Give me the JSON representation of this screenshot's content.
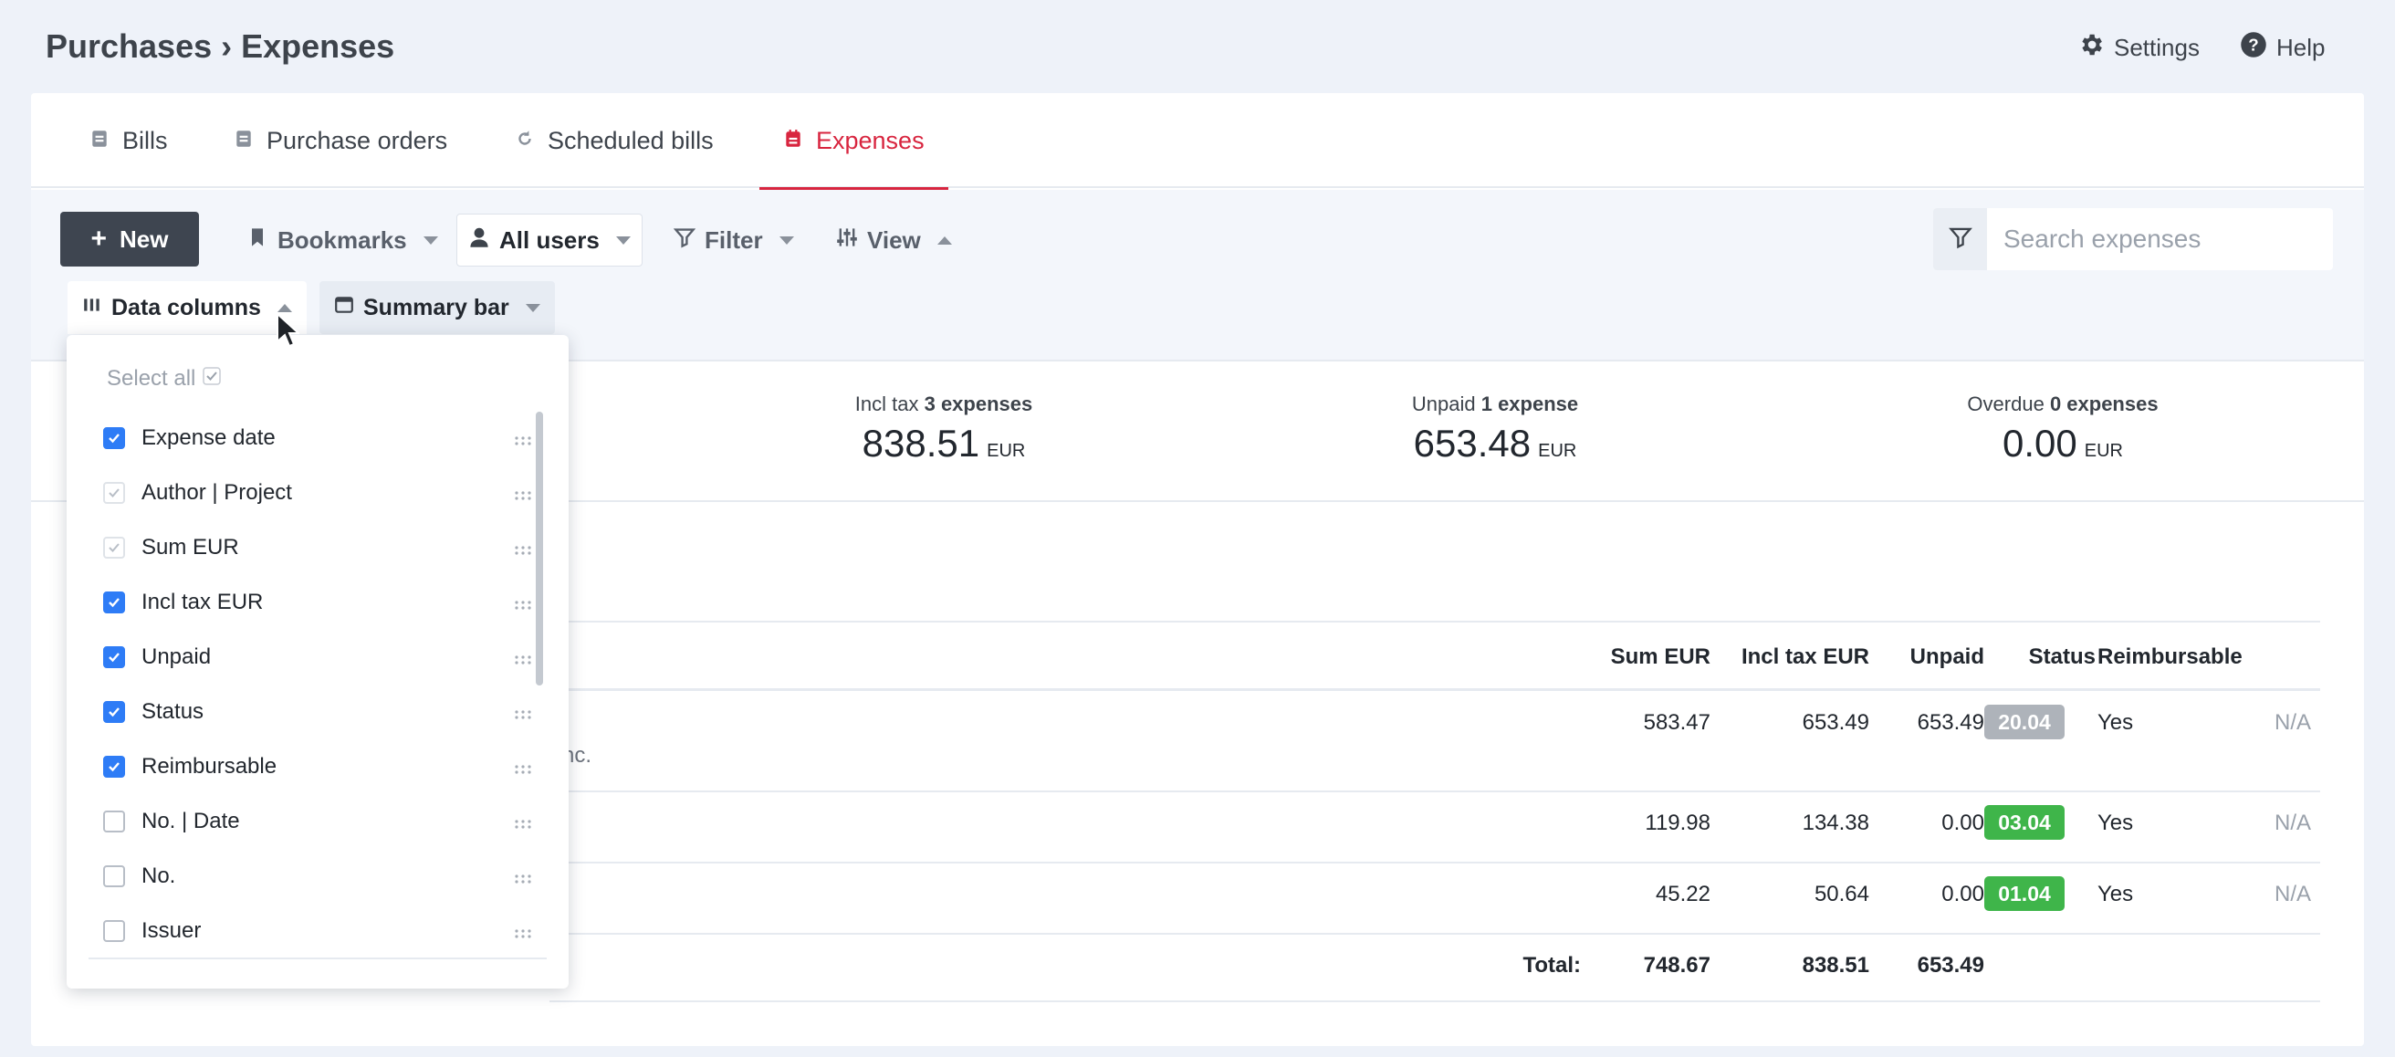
{
  "header": {
    "breadcrumb": "Purchases › Expenses",
    "settings_label": "Settings",
    "help_label": "Help"
  },
  "tabs": [
    {
      "label": "Bills",
      "icon": "document-icon"
    },
    {
      "label": "Purchase orders",
      "icon": "document-icon"
    },
    {
      "label": "Scheduled bills",
      "icon": "refresh-icon"
    },
    {
      "label": "Expenses",
      "icon": "calendar-icon",
      "active": true
    }
  ],
  "toolbar": {
    "new_label": "New",
    "bookmarks_label": "Bookmarks",
    "users_label": "All users",
    "filter_label": "Filter",
    "view_label": "View",
    "search_placeholder": "Search expenses",
    "data_columns_label": "Data columns",
    "summary_bar_label": "Summary bar"
  },
  "summary": {
    "incl_tax": {
      "label": "Incl tax",
      "count": "3 expenses",
      "value": "838.51",
      "currency": "EUR"
    },
    "unpaid": {
      "label": "Unpaid",
      "count": "1 expense",
      "value": "653.48",
      "currency": "EUR"
    },
    "overdue": {
      "label": "Overdue",
      "count": "0 expenses",
      "value": "0.00",
      "currency": "EUR"
    }
  },
  "table": {
    "headers": {
      "sum": "Sum EUR",
      "incl_tax": "Incl tax EUR",
      "unpaid": "Unpaid",
      "status": "Status",
      "reimbursable": "Reimbursable"
    },
    "rows": [
      {
        "partial_text": "nc.",
        "sum": "583.47",
        "incl_tax": "653.49",
        "unpaid": "653.49",
        "status": "20.04",
        "status_color": "#aeb3ba",
        "reimbursable": "Yes",
        "extra": "N/A"
      },
      {
        "partial_text": "",
        "sum": "119.98",
        "incl_tax": "134.38",
        "unpaid": "0.00",
        "status": "03.04",
        "status_color": "#3fb54a",
        "reimbursable": "Yes",
        "extra": "N/A"
      },
      {
        "partial_text": "",
        "sum": "45.22",
        "incl_tax": "50.64",
        "unpaid": "0.00",
        "status": "01.04",
        "status_color": "#3fb54a",
        "reimbursable": "Yes",
        "extra": "N/A"
      }
    ],
    "total": {
      "label": "Total:",
      "sum": "748.67",
      "incl_tax": "838.51",
      "unpaid": "653.49"
    }
  },
  "columns_dropdown": {
    "select_all_label": "Select all",
    "items": [
      {
        "label": "Expense date",
        "state": "checked"
      },
      {
        "label": "Author | Project",
        "state": "locked"
      },
      {
        "label": "Sum EUR",
        "state": "locked"
      },
      {
        "label": "Incl tax EUR",
        "state": "checked"
      },
      {
        "label": "Unpaid",
        "state": "checked"
      },
      {
        "label": "Status",
        "state": "checked"
      },
      {
        "label": "Reimbursable",
        "state": "checked"
      },
      {
        "label": "No. | Date",
        "state": "unchecked"
      },
      {
        "label": "No.",
        "state": "unchecked"
      },
      {
        "label": "Issuer",
        "state": "unchecked"
      }
    ]
  }
}
